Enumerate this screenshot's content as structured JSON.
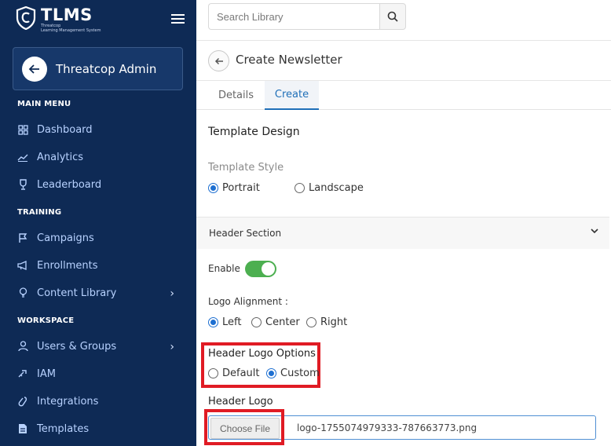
{
  "brand": {
    "title": "TLMS",
    "sub1": "Threatcop",
    "sub2": "Learning Management System"
  },
  "admin": {
    "name": "Threatcop Admin"
  },
  "sections": {
    "main_menu": "MAIN MENU",
    "training": "TRAINING",
    "workspace": "WORKSPACE"
  },
  "nav": {
    "dashboard": "Dashboard",
    "analytics": "Analytics",
    "leaderboard": "Leaderboard",
    "campaigns": "Campaigns",
    "enrollments": "Enrollments",
    "content_library": "Content Library",
    "users_groups": "Users & Groups",
    "iam": "IAM",
    "integrations": "Integrations",
    "templates": "Templates"
  },
  "search": {
    "placeholder": "Search Library"
  },
  "page": {
    "title": "Create Newsletter"
  },
  "tabs": {
    "details": "Details",
    "create": "Create"
  },
  "form": {
    "template_design": "Template Design",
    "template_style": "Template Style",
    "portrait": "Portrait",
    "landscape": "Landscape",
    "header_section": "Header Section",
    "enable": "Enable",
    "enable_on": true,
    "logo_alignment": "Logo Alignment :",
    "left": "Left",
    "center": "Center",
    "right": "Right",
    "header_logo_options": "Header Logo Options",
    "default": "Default",
    "custom": "Custom",
    "header_logo": "Header Logo",
    "choose_file": "Choose File",
    "file_name": "logo-1755074979333-787663773.png"
  },
  "colors": {
    "sidebar": "#0e2a55",
    "accent": "#1d6fd1",
    "toggle": "#4caf50",
    "highlight": "#e01b24"
  }
}
